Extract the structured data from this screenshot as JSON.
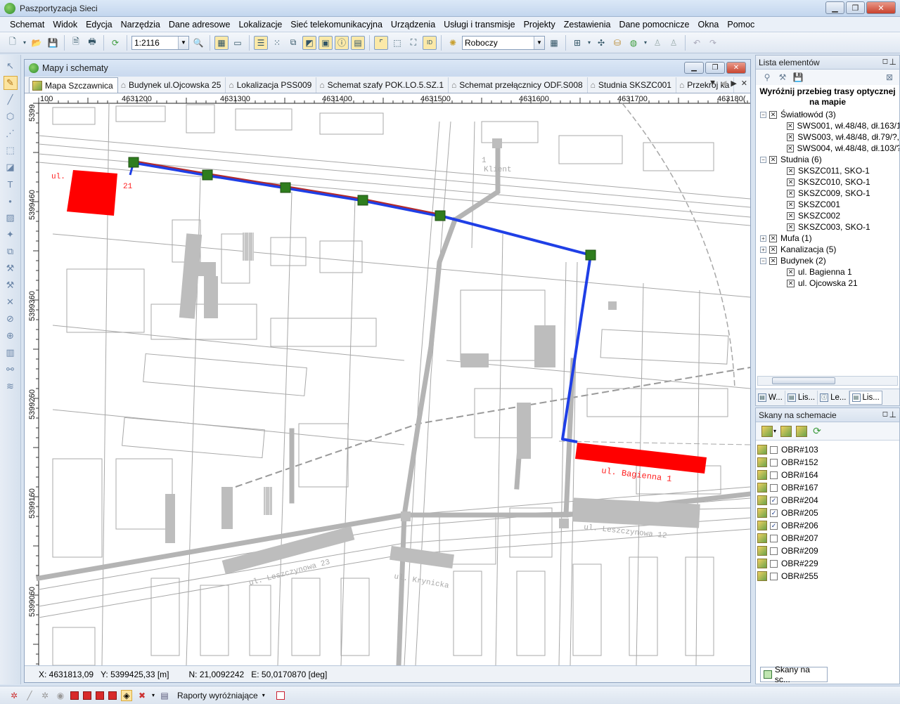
{
  "app": {
    "title": "Paszportyzacja Sieci"
  },
  "menu": {
    "items": [
      "Schemat",
      "Widok",
      "Edycja",
      "Narzędzia",
      "Dane adresowe",
      "Lokalizacje",
      "Sieć telekomunikacyjna",
      "Urządzenia",
      "Usługi i transmisje",
      "Projekty",
      "Zestawienia",
      "Dane pomocnicze",
      "Okna",
      "Pomoc"
    ]
  },
  "toolbar": {
    "scale_value": "1:2116",
    "mode_value": "Roboczy"
  },
  "map_window": {
    "title": "Mapy i schematy",
    "tabs": [
      "Mapa Szczawnica",
      "Budynek ul.Ojcowska 25",
      "Lokalizacja PSS009",
      "Schemat szafy POK.LO.5.SZ.1",
      "Schemat przełącznicy ODF.S008",
      "Studnia SKSZC001",
      "Przekrój ka"
    ],
    "ruler_top": [
      "100",
      "4631200",
      "4631300",
      "4631400",
      "4631500",
      "4631600",
      "4631700",
      "463180("
    ],
    "ruler_left": [
      "5399",
      "5399460",
      "5399360",
      "5399260",
      "5399160",
      "5399060"
    ],
    "map_labels": {
      "building_small": "ul.",
      "building_small_num": "21",
      "building_long": "ul. Bagienna 1",
      "klient": "Klient",
      "klient_prefix": "1",
      "street_leszczynowa_right": "ul. Leszczynowa 12",
      "street_leszczynowa_left": "ul. Leszczynowa 23",
      "street_krynicka": "ul. Krynicka"
    },
    "status": {
      "x": "X: 4631813,09",
      "y": "Y: 5399425,33 [m]",
      "n": "N: 21,0092242",
      "e": "E: 50,0170870 [deg]"
    }
  },
  "colors": {
    "route_blue": "#1f3fe6",
    "route_red": "#b22a2a",
    "node_green": "#2f7d1e",
    "highlight_red": "#ff0000",
    "map_gray": "#b4b4b4"
  },
  "lista": {
    "title": "Lista elementów",
    "caption": "Wyróżnij przebieg trasy optycznej na mapie",
    "tree": [
      {
        "label": "Światłowód (3)",
        "level": 0,
        "expanded": true
      },
      {
        "label": "SWS001, wł.48/48, dł.163/1",
        "level": 1
      },
      {
        "label": "SWS003, wł.48/48, dł.79/?,",
        "level": 1
      },
      {
        "label": "SWS004, wł.48/48, dł.103/?",
        "level": 1
      },
      {
        "label": "Studnia (6)",
        "level": 0,
        "expanded": true
      },
      {
        "label": "SKSZC011, SKO-1",
        "level": 1
      },
      {
        "label": "SKSZC010, SKO-1",
        "level": 1
      },
      {
        "label": "SKSZC009, SKO-1",
        "level": 1
      },
      {
        "label": "SKSZC001",
        "level": 1
      },
      {
        "label": "SKSZC002",
        "level": 1
      },
      {
        "label": "SKSZC003, SKO-1",
        "level": 1
      },
      {
        "label": "Mufa (1)",
        "level": 0,
        "expanded": false
      },
      {
        "label": "Kanalizacja (5)",
        "level": 0,
        "expanded": false
      },
      {
        "label": "Budynek (2)",
        "level": 0,
        "expanded": true
      },
      {
        "label": "ul. Bagienna 1",
        "level": 1
      },
      {
        "label": "ul. Ojcowska 21",
        "level": 1
      }
    ],
    "bottom_tabs": [
      "W...",
      "Lis...",
      "Le...",
      "Lis..."
    ]
  },
  "skany": {
    "title": "Skany na schemacie",
    "items": [
      {
        "label": "OBR#103",
        "checked": false
      },
      {
        "label": "OBR#152",
        "checked": false
      },
      {
        "label": "OBR#164",
        "checked": false
      },
      {
        "label": "OBR#167",
        "checked": false
      },
      {
        "label": "OBR#204",
        "checked": true
      },
      {
        "label": "OBR#205",
        "checked": true
      },
      {
        "label": "OBR#206",
        "checked": true
      },
      {
        "label": "OBR#207",
        "checked": false
      },
      {
        "label": "OBR#209",
        "checked": false
      },
      {
        "label": "OBR#229",
        "checked": false
      },
      {
        "label": "OBR#255",
        "checked": false
      }
    ],
    "bottom_tab": "Skany na sc..."
  },
  "bottombar": {
    "reports_label": "Raporty wyróżniające"
  }
}
